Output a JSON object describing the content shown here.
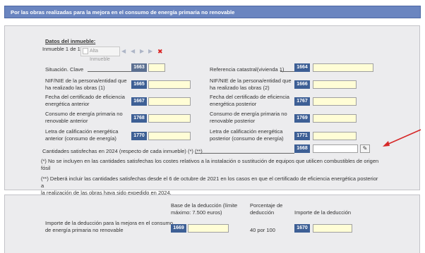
{
  "header": {
    "title": "Por las obras realizadas para la mejora en el consumo de energía primaria no renovable"
  },
  "inmueble": {
    "section_title": "Datos del inmueble:",
    "counter": "Inmueble 1 de 1",
    "alta_label": "Alta Inmueble",
    "nav_first": "◀",
    "nav_prev": "◀",
    "nav_next": "▶",
    "nav_last": "▶",
    "delete_glyph": "✖"
  },
  "fields": {
    "situacion": {
      "label": "Situación. Clave",
      "code": "1663",
      "value": ""
    },
    "referencia": {
      "label": "Referencia catastral(vivienda 1)",
      "code": "1664",
      "value": ""
    },
    "nif_anterior": {
      "label_1": "NIF/NIE de la persona/entidad que",
      "label_2": "ha realizado las obras (1)",
      "code": "1665",
      "value": ""
    },
    "nif_posterior": {
      "label_1": "NIF/NIE de la persona/entidad que",
      "label_2": "ha realizado las obras (2)",
      "code": "1666",
      "value": ""
    },
    "fecha_anterior": {
      "label_1": "Fecha del certificado de eficiencia",
      "label_2": "energética anterior",
      "code": "1667",
      "value": ""
    },
    "fecha_posterior": {
      "label_1": "Fecha del certificado de eficiencia",
      "label_2": "energética posterior",
      "code": "1767",
      "value": ""
    },
    "consumo_anterior": {
      "label_1": "Consumo de energía primaria no",
      "label_2": "renovable anterior",
      "code": "1768",
      "value": ""
    },
    "consumo_posterior": {
      "label_1": "Consumo de energía primaria no",
      "label_2": "renovable posterior",
      "code": "1769",
      "value": ""
    },
    "letra_anterior": {
      "label_1": "Letra de calificación energética",
      "label_2": "anterior (consumo de energía)",
      "code": "1770",
      "value": ""
    },
    "letra_posterior": {
      "label_1": "Letra de calificación energética",
      "label_2": "posterior (consumo de energía)",
      "code": "1771",
      "value": ""
    },
    "cantidades": {
      "label": "Cantidades satisfechas en 2024 (respecto de cada inmueble) (*) (**)",
      "code": "1668",
      "value": "",
      "edit_glyph": "✎"
    }
  },
  "notes": {
    "note_1_line_1": "(*) No se incluyen en las cantidades satisfechas los costes relativos a la instalación o sustitución de equipos que utilicen combustibles de origen",
    "note_1_line_2": "fósil",
    "note_2_line_1": "(**) Deberá incluir las cantidades satisfechas desde el 6 de octubre de 2021 en los casos en que el certificado de eficiencia energética posterior a",
    "note_2_line_2": "la realización de las obras haya sido expedido en 2024."
  },
  "deduccion": {
    "col_base_1": "Base de la deducción (límite",
    "col_base_2": "máximo: 7.500 euros)",
    "col_pct_1": "Porcentaje de",
    "col_pct_2": "deducción",
    "col_importe": "Importe de la deducción",
    "row_label_1": "Importe de la deducción para la mejora en el consumo",
    "row_label_2": "de energía primaria no renovable",
    "base_code": "1669",
    "base_value": "",
    "pct_value": "40 por 100",
    "importe_code": "1670",
    "importe_value": ""
  },
  "colors": {
    "header_bg": "#6a85c0",
    "code_bg": "#3d5f95",
    "input_bg": "#fffdd6",
    "arrow": "#d62828"
  }
}
